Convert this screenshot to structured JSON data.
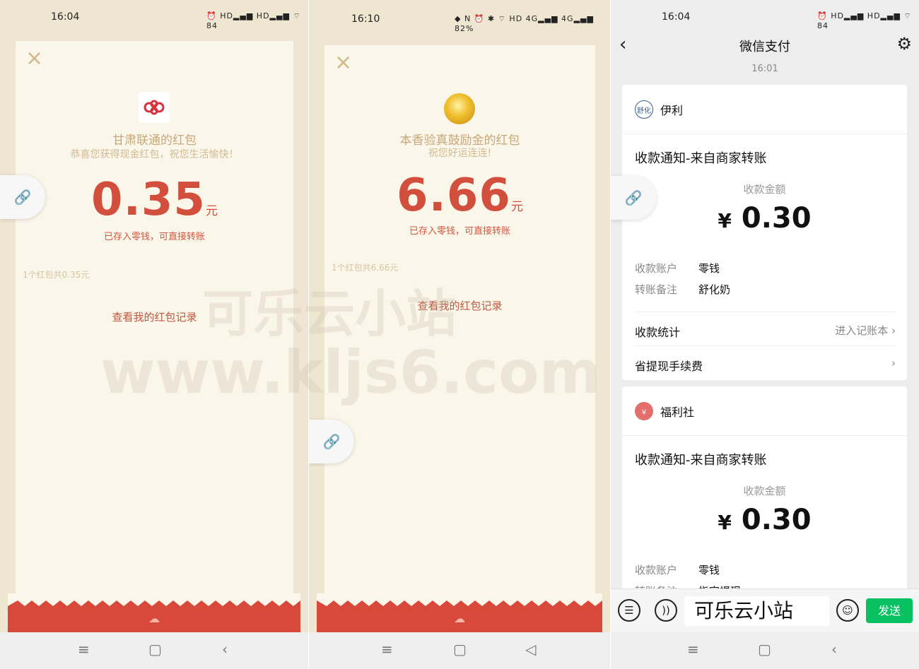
{
  "panel1": {
    "status": {
      "time": "16:04",
      "icons": "⏰ HD▂▄▆ HD▂▄▆ ⌔ 84"
    },
    "close_icon": "×",
    "logo": "china-unicom-knot-icon",
    "title": "甘肃联通的红包",
    "subtitle": "恭喜您获得现金红包，祝您生活愉快！",
    "amount": "0.35",
    "unit": "元",
    "note": "已存入零钱，可直接转账",
    "count_text": "1个红包共0.35元",
    "record_link": "查看我的红包记录",
    "nav": {
      "menu": "≡",
      "home": "▢",
      "back": "‹"
    }
  },
  "panel2": {
    "status": {
      "time": "16:10",
      "icons": "◆ N ⏰ ✱ ⌔ HD 4G▂▄▆ 4G▂▄▆ 82%"
    },
    "close_icon": "×",
    "logo": "gold-coin-icon",
    "title": "本香验真鼓励金的红包",
    "subtitle": "祝您好运连连!",
    "amount": "6.66",
    "unit": "元",
    "note": "已存入零钱，可直接转账",
    "count_text": "1个红包共6.66元",
    "record_link": "查看我的红包记录",
    "nav": {
      "menu": "≡",
      "home": "▢",
      "back": "◁"
    }
  },
  "watermark": {
    "line1": "可乐云小站",
    "line2": "www.kljs6.com"
  },
  "wechat": {
    "status": {
      "time": "16:04",
      "icons": "⏰ HD▂▄▆ HD▂▄▆ ⌔ 84"
    },
    "title": "微信支付",
    "msg_time": "16:01",
    "cards": [
      {
        "merchant": "伊利",
        "merchant_avatar": "舒化",
        "notice_title": "收款通知-来自商家转账",
        "amount_label": "收款金额",
        "currency": "¥",
        "amount": "0.30",
        "rows": [
          {
            "key": "收款账户",
            "value": "零钱"
          },
          {
            "key": "转账备注",
            "value": "舒化奶"
          }
        ],
        "stats_label": "收款统计",
        "stats_link": "进入记账本",
        "fee_label": "省提现手续费"
      },
      {
        "merchant": "福利社",
        "merchant_avatar": "￥",
        "notice_title": "收款通知-来自商家转账",
        "amount_label": "收款金额",
        "currency": "¥",
        "amount": "0.30",
        "rows": [
          {
            "key": "收款账户",
            "value": "零钱"
          },
          {
            "key": "转账备注",
            "value": "指定提现"
          }
        ]
      }
    ],
    "input": {
      "text": "可乐云小站",
      "send_label": "发送"
    },
    "nav": {
      "menu": "≡",
      "home": "▢",
      "back": "‹"
    }
  },
  "colors": {
    "red_accent": "#d24f3d",
    "wechat_green": "#07c160",
    "cream": "#fbf6ea"
  }
}
